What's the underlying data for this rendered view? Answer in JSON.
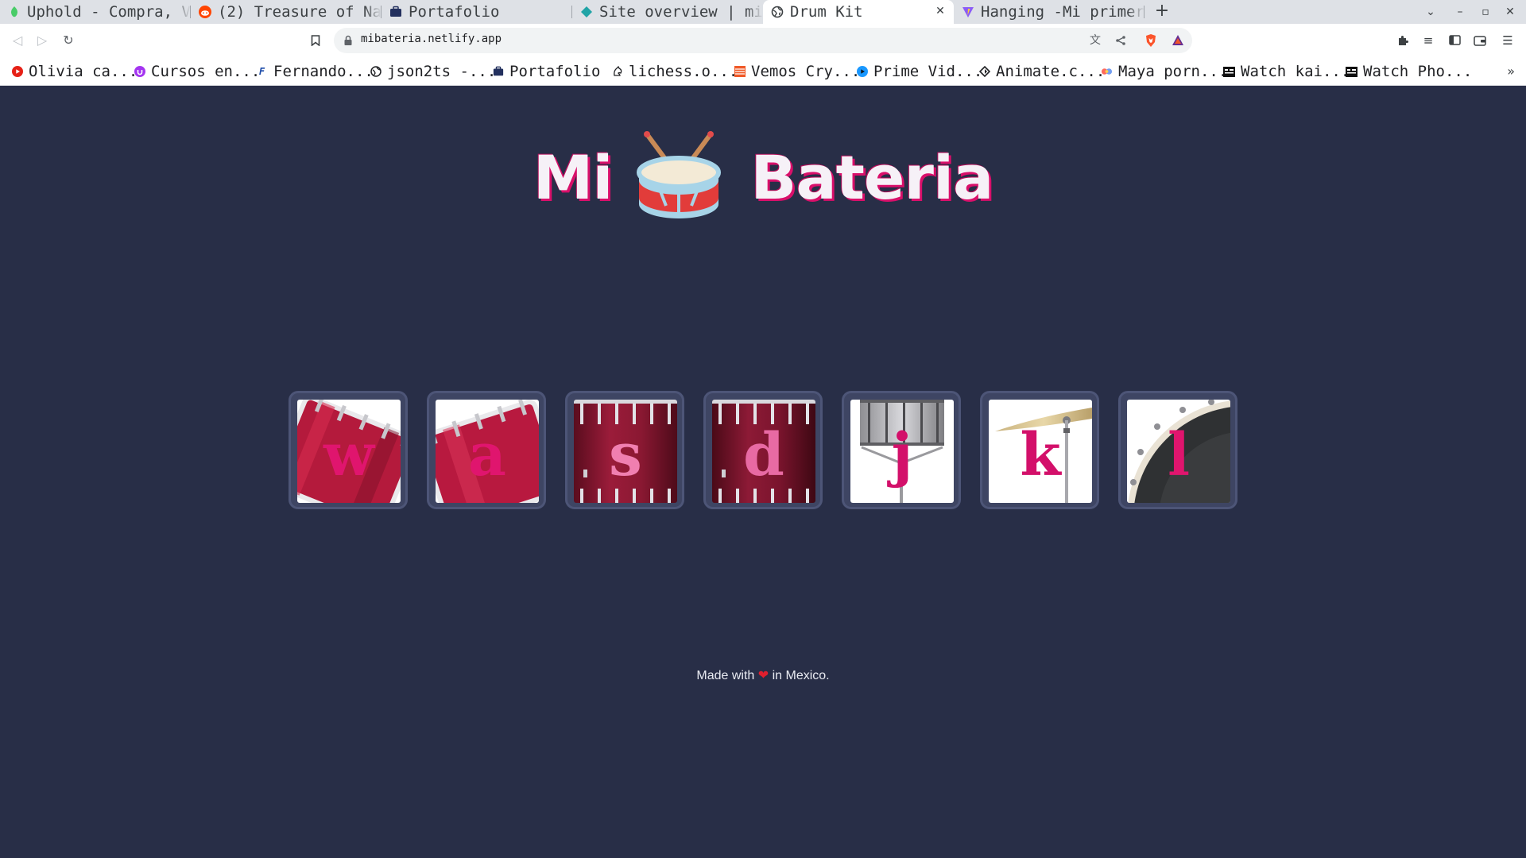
{
  "browser": {
    "tabs": [
      {
        "title": "Uphold - Compra, V",
        "icon": "uphold-icon",
        "active": false
      },
      {
        "title": "(2) Treasure of Na",
        "icon": "reddit-icon",
        "active": false
      },
      {
        "title": "Portafolio",
        "icon": "briefcase-icon",
        "active": false
      },
      {
        "title": "Site overview | mi",
        "icon": "netlify-icon",
        "active": false
      },
      {
        "title": "Drum Kit",
        "icon": "globe-icon",
        "active": true
      },
      {
        "title": "Hanging -Mi primer",
        "icon": "vite-icon",
        "active": false
      }
    ],
    "address": {
      "url": "mibateria.netlify.app"
    },
    "bookmarks": [
      {
        "label": "Olivia ca...",
        "icon": "youtube-icon"
      },
      {
        "label": "Cursos en...",
        "icon": "udemy-icon"
      },
      {
        "label": "Fernando...",
        "icon": "fh-icon"
      },
      {
        "label": "json2ts -...",
        "icon": "globe-icon"
      },
      {
        "label": "Portafolio",
        "icon": "briefcase-icon"
      },
      {
        "label": "lichess.o...",
        "icon": "lichess-icon"
      },
      {
        "label": "Vemos Cry...",
        "icon": "vemos-icon"
      },
      {
        "label": "Prime Vid...",
        "icon": "prime-video-icon"
      },
      {
        "label": "Animate.c...",
        "icon": "animate-icon"
      },
      {
        "label": "Maya porn...",
        "icon": "colorful-icon"
      },
      {
        "label": "Watch kai...",
        "icon": "film-icon"
      },
      {
        "label": "Watch Pho...",
        "icon": "film-icon"
      }
    ]
  },
  "page": {
    "title_left": "Mi",
    "title_right": "Bateria",
    "logo_icon": "drum-icon",
    "keys": [
      {
        "key": "w",
        "icon": "tom-drum-icon"
      },
      {
        "key": "a",
        "icon": "tom-drum-icon"
      },
      {
        "key": "s",
        "icon": "floor-tom-icon"
      },
      {
        "key": "d",
        "icon": "floor-tom-icon"
      },
      {
        "key": "j",
        "icon": "snare-drum-icon"
      },
      {
        "key": "k",
        "icon": "cymbal-icon"
      },
      {
        "key": "l",
        "icon": "bass-drum-icon"
      }
    ],
    "footer": {
      "before": "Made with",
      "heart": "❤",
      "after": "in Mexico."
    }
  },
  "colors": {
    "background": "#282e47",
    "key_frame": "#3e4563",
    "accent_pink": "#e0156e",
    "title_text": "#f6f1f7",
    "drum_red": "#c0183e"
  }
}
